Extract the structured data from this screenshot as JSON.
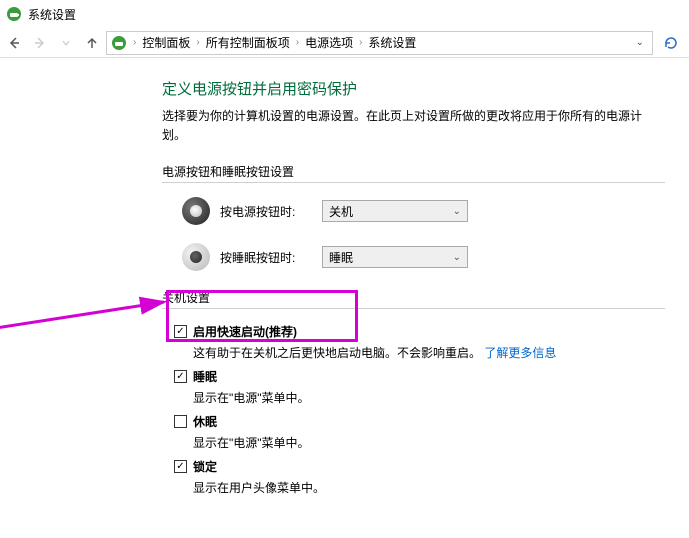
{
  "window": {
    "title": "系统设置"
  },
  "breadcrumb": {
    "items": [
      "控制面板",
      "所有控制面板项",
      "电源选项",
      "系统设置"
    ]
  },
  "page": {
    "heading": "定义电源按钮并启用密码保护",
    "subtext": "选择要为你的计算机设置的电源设置。在此页上对设置所做的更改将应用于你所有的电源计划。"
  },
  "sections": {
    "buttons_label": "电源按钮和睡眠按钮设置",
    "shutdown_label": "关机设置"
  },
  "settings": {
    "power_button": {
      "label": "按电源按钮时:",
      "value": "关机"
    },
    "sleep_button": {
      "label": "按睡眠按钮时:",
      "value": "睡眠"
    }
  },
  "shutdown_opts": {
    "fast_startup": {
      "label": "启用快速启动(推荐)",
      "desc_before": "这有助于在关机之后更快地启动电脑。不会影响重启。",
      "link": "了解更多信息"
    },
    "sleep": {
      "label": "睡眠",
      "desc": "显示在\"电源\"菜单中。"
    },
    "hibernate": {
      "label": "休眠",
      "desc": "显示在\"电源\"菜单中。"
    },
    "lock": {
      "label": "锁定",
      "desc": "显示在用户头像菜单中。"
    }
  }
}
